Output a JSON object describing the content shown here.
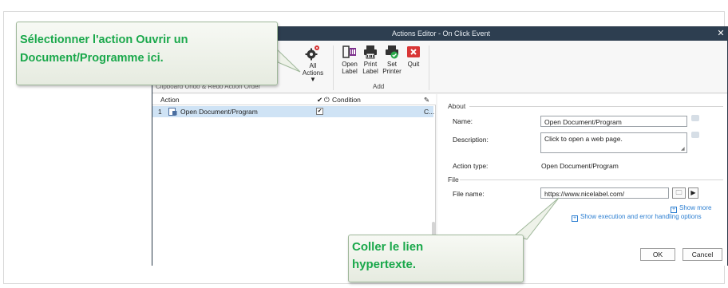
{
  "window": {
    "title": "Actions Editor - On Click Event",
    "close_glyph": "✕"
  },
  "ribbon": {
    "all_actions": {
      "line1": "All",
      "line2": "Actions ▼"
    },
    "open_label": {
      "line1": "Open",
      "line2": "Label"
    },
    "print_label": {
      "line1": "Print",
      "line2": "Label"
    },
    "set_printer": {
      "line1": "Set",
      "line2": "Printer"
    },
    "quit": {
      "line1": "Quit"
    },
    "group_add": "Add",
    "group_partial": "Clipboard    Undo & Redo    Action Order"
  },
  "grid": {
    "col_action": "Action",
    "col_condition": "Condition",
    "col_condition_check": "✔",
    "col_condition_icon": "⏻",
    "edit_icon": "✎",
    "rows": [
      {
        "num": "1",
        "action": "Open Document/Program",
        "checked": "✔",
        "extra": "C..."
      }
    ]
  },
  "about": {
    "section": "About",
    "name_label": "Name:",
    "name_value": "Open Document/Program",
    "description_label": "Description:",
    "description_value": "Click to open a web page.",
    "action_type_label": "Action type:",
    "action_type_value": "Open Document/Program"
  },
  "file": {
    "section": "File",
    "file_name_label": "File name:",
    "file_name_value": "https://www.nicelabel.com/",
    "folder_glyph": "🗀",
    "arrow_glyph": "▶"
  },
  "links": {
    "show_more": "Show more",
    "show_execution": "Show execution and error handling options",
    "plus_glyph": "+"
  },
  "buttons": {
    "ok": "OK",
    "cancel": "Cancel"
  },
  "callouts": {
    "top": {
      "line1": "Sélectionner l'action Ouvrir un",
      "line2": "Document/Programme ici."
    },
    "bottom": {
      "line1": "Coller le lien",
      "line2": "hypertexte."
    }
  },
  "colors": {
    "callout_text": "#1aa84b",
    "titlebar": "#2d3e50",
    "selection": "#cfe3f5",
    "link": "#2d7fd1"
  }
}
